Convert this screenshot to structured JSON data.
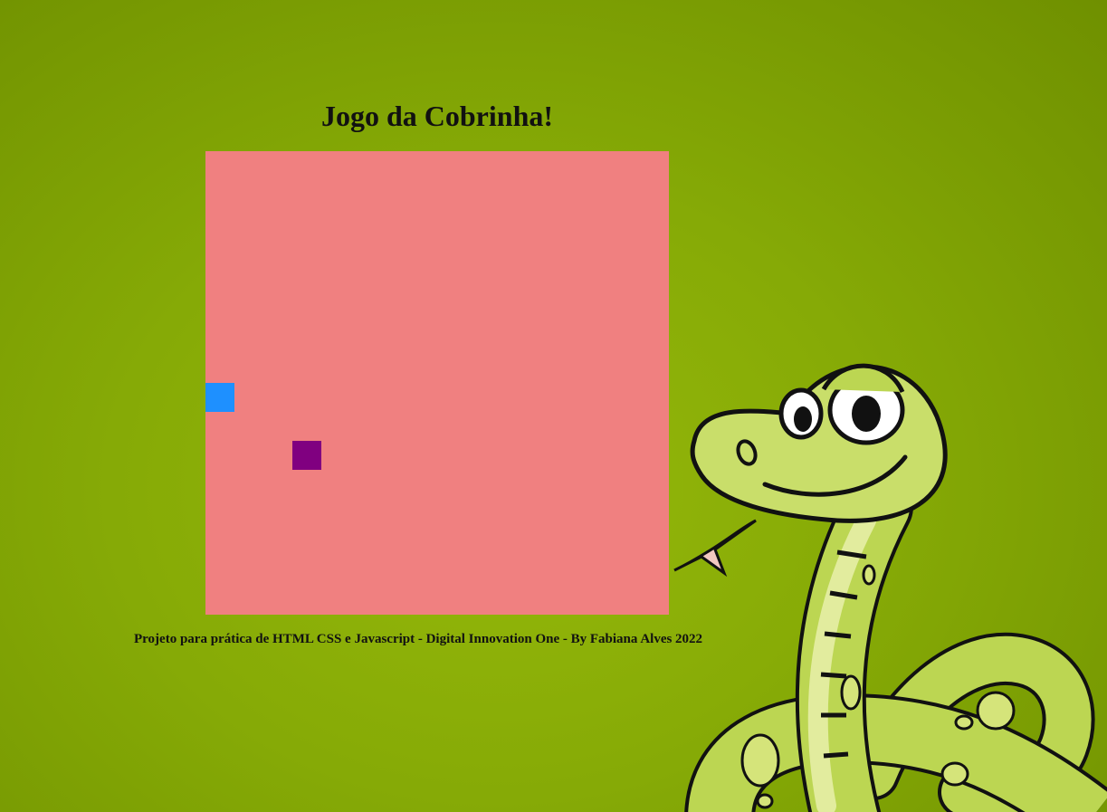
{
  "page": {
    "title": "Jogo da Cobrinha!",
    "footer": "Projeto para prática de HTML CSS e Javascript - Digital Innovation One - By Fabiana Alves 2022"
  },
  "game": {
    "grid_size": 16,
    "board_color": "#f08080",
    "snake_color": "#1e90ff",
    "food_color": "#800080",
    "snake": [
      {
        "col": 0,
        "row": 8
      }
    ],
    "food": {
      "col": 3,
      "row": 10
    }
  },
  "colors": {
    "background": "#86aa06",
    "text": "#111111"
  },
  "decor": {
    "mascot_icon": "cartoon-snake-illustration"
  }
}
